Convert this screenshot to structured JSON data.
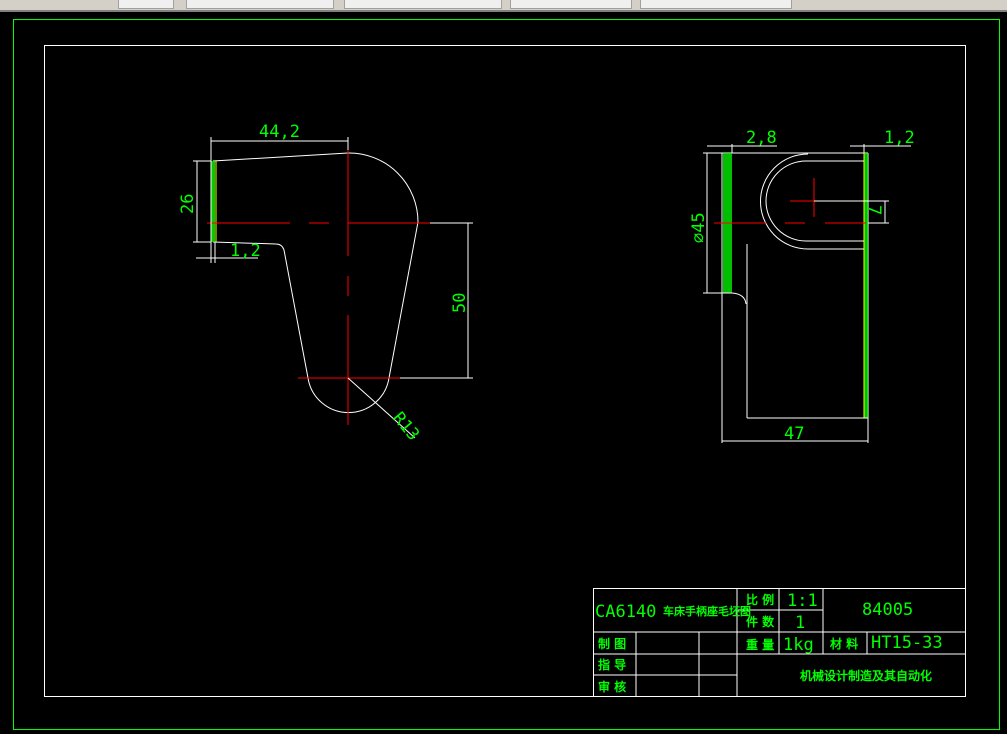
{
  "app": {
    "toolbar_state": "partially visible"
  },
  "colors": {
    "background": "#000000",
    "frame": "#00ff00",
    "geometry": "#ffffff",
    "centerline": "#ff0000",
    "dimension_text": "#00ff00",
    "hatch": "#00ff00"
  },
  "drawing": {
    "front_view": {
      "dim_width": "44,2",
      "dim_height": "26",
      "dim_thickness": "1,2",
      "dim_center_distance": "50",
      "dim_radius": "R13"
    },
    "side_view": {
      "dim_left_wall": "2,8",
      "dim_right_wall": "1,2",
      "dim_diameter": "⌀45",
      "dim_offset": "7",
      "dim_length": "47"
    }
  },
  "title_block": {
    "title": "CA6140",
    "title_cn": "车床手柄座毛坯图",
    "scale_label": "比 例",
    "scale_value": "1:1",
    "quantity_label": "件 数",
    "quantity_value": "1",
    "drawing_number": "84005",
    "weight_label": "重 量",
    "weight_value": "1kg",
    "material_label": "材 料",
    "material_value": "HT15-33",
    "drawn_label": "制 图",
    "guide_label": "指 导",
    "review_label": "审 核",
    "institution": "机械设计制造及其自动化"
  }
}
